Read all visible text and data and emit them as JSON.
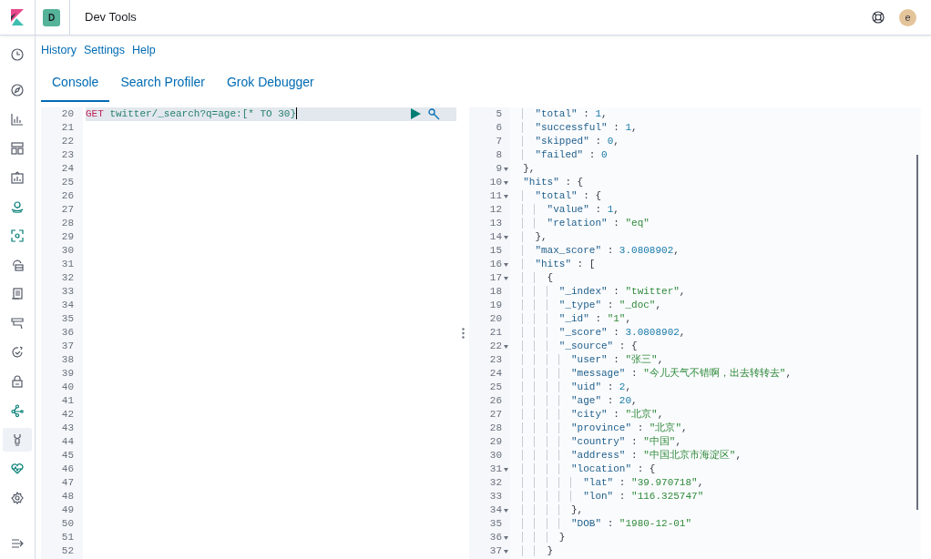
{
  "header": {
    "app_badge": "D",
    "title": "Dev Tools",
    "avatar": "e"
  },
  "nav_items": [
    {
      "selected": false
    },
    {
      "selected": false
    },
    {
      "selected": false
    },
    {
      "selected": false
    },
    {
      "selected": false
    },
    {
      "selected": false
    },
    {
      "selected": false
    },
    {
      "selected": false
    },
    {
      "selected": false
    },
    {
      "selected": false
    },
    {
      "selected": false
    },
    {
      "selected": false
    },
    {
      "selected": false
    },
    {
      "selected": true
    },
    {
      "selected": false
    },
    {
      "selected": false
    }
  ],
  "top_links": [
    "History",
    "Settings",
    "Help"
  ],
  "tabs": [
    {
      "label": "Console",
      "selected": true
    },
    {
      "label": "Search Profiler",
      "selected": false
    },
    {
      "label": "Grok Debugger",
      "selected": false
    }
  ],
  "request_editor": {
    "lines": [
      {
        "n": "20",
        "selected": true,
        "tokens": [
          {
            "kind": "method",
            "text": "GET"
          },
          {
            "kind": "path",
            "text": "twitter/_search?q=age:[* TO 30}"
          }
        ]
      },
      {
        "n": "21",
        "selected": false
      },
      {
        "n": "22",
        "selected": false
      },
      {
        "n": "23",
        "selected": false
      },
      {
        "n": "24",
        "selected": false
      },
      {
        "n": "25",
        "selected": false
      },
      {
        "n": "26",
        "selected": false
      },
      {
        "n": "27",
        "selected": false
      },
      {
        "n": "28",
        "selected": false
      },
      {
        "n": "29",
        "selected": false
      },
      {
        "n": "30",
        "selected": false
      },
      {
        "n": "31",
        "selected": false
      },
      {
        "n": "32",
        "selected": false
      },
      {
        "n": "33",
        "selected": false
      },
      {
        "n": "34",
        "selected": false
      },
      {
        "n": "35",
        "selected": false
      },
      {
        "n": "36",
        "selected": false
      },
      {
        "n": "37",
        "selected": false
      },
      {
        "n": "38",
        "selected": false
      },
      {
        "n": "39",
        "selected": false
      },
      {
        "n": "40",
        "selected": false
      },
      {
        "n": "41",
        "selected": false
      },
      {
        "n": "42",
        "selected": false
      },
      {
        "n": "43",
        "selected": false
      },
      {
        "n": "44",
        "selected": false
      },
      {
        "n": "45",
        "selected": false
      },
      {
        "n": "46",
        "selected": false
      },
      {
        "n": "47",
        "selected": false
      },
      {
        "n": "48",
        "selected": false
      },
      {
        "n": "49",
        "selected": false
      },
      {
        "n": "50",
        "selected": false
      },
      {
        "n": "51",
        "selected": false
      },
      {
        "n": "52",
        "selected": false
      }
    ]
  },
  "response_viewer": {
    "lines": [
      {
        "n": "5",
        "fold": false,
        "tokens": [
          {
            "kind": "key",
            "text": "    \"total\""
          },
          {
            "kind": "punct",
            "text": " : "
          },
          {
            "kind": "num",
            "text": "1"
          },
          {
            "kind": "punct",
            "text": ","
          }
        ]
      },
      {
        "n": "6",
        "fold": false,
        "tokens": [
          {
            "kind": "key",
            "text": "    \"successful\""
          },
          {
            "kind": "punct",
            "text": " : "
          },
          {
            "kind": "num",
            "text": "1"
          },
          {
            "kind": "punct",
            "text": ","
          }
        ]
      },
      {
        "n": "7",
        "fold": false,
        "tokens": [
          {
            "kind": "key",
            "text": "    \"skipped\""
          },
          {
            "kind": "punct",
            "text": " : "
          },
          {
            "kind": "num",
            "text": "0"
          },
          {
            "kind": "punct",
            "text": ","
          }
        ]
      },
      {
        "n": "8",
        "fold": false,
        "tokens": [
          {
            "kind": "key",
            "text": "    \"failed\""
          },
          {
            "kind": "punct",
            "text": " : "
          },
          {
            "kind": "num",
            "text": "0"
          }
        ]
      },
      {
        "n": "9",
        "fold": true,
        "tokens": [
          {
            "kind": "punct",
            "text": "  },"
          }
        ]
      },
      {
        "n": "10",
        "fold": true,
        "tokens": [
          {
            "kind": "key",
            "text": "  \"hits\""
          },
          {
            "kind": "punct",
            "text": " : {"
          }
        ]
      },
      {
        "n": "11",
        "fold": true,
        "tokens": [
          {
            "kind": "key",
            "text": "    \"total\""
          },
          {
            "kind": "punct",
            "text": " : {"
          }
        ]
      },
      {
        "n": "12",
        "fold": false,
        "tokens": [
          {
            "kind": "key",
            "text": "      \"value\""
          },
          {
            "kind": "punct",
            "text": " : "
          },
          {
            "kind": "num",
            "text": "1"
          },
          {
            "kind": "punct",
            "text": ","
          }
        ]
      },
      {
        "n": "13",
        "fold": false,
        "tokens": [
          {
            "kind": "key",
            "text": "      \"relation\""
          },
          {
            "kind": "punct",
            "text": " : "
          },
          {
            "kind": "str",
            "text": "\"eq\""
          }
        ]
      },
      {
        "n": "14",
        "fold": true,
        "tokens": [
          {
            "kind": "punct",
            "text": "    },"
          }
        ]
      },
      {
        "n": "15",
        "fold": false,
        "tokens": [
          {
            "kind": "key",
            "text": "    \"max_score\""
          },
          {
            "kind": "punct",
            "text": " : "
          },
          {
            "kind": "num",
            "text": "3.0808902"
          },
          {
            "kind": "punct",
            "text": ","
          }
        ]
      },
      {
        "n": "16",
        "fold": true,
        "tokens": [
          {
            "kind": "key",
            "text": "    \"hits\""
          },
          {
            "kind": "punct",
            "text": " : ["
          }
        ]
      },
      {
        "n": "17",
        "fold": true,
        "tokens": [
          {
            "kind": "punct",
            "text": "      {"
          }
        ]
      },
      {
        "n": "18",
        "fold": false,
        "tokens": [
          {
            "kind": "key",
            "text": "        \"_index\""
          },
          {
            "kind": "punct",
            "text": " : "
          },
          {
            "kind": "str",
            "text": "\"twitter\""
          },
          {
            "kind": "punct",
            "text": ","
          }
        ]
      },
      {
        "n": "19",
        "fold": false,
        "tokens": [
          {
            "kind": "key",
            "text": "        \"_type\""
          },
          {
            "kind": "punct",
            "text": " : "
          },
          {
            "kind": "str",
            "text": "\"_doc\""
          },
          {
            "kind": "punct",
            "text": ","
          }
        ]
      },
      {
        "n": "20",
        "fold": false,
        "tokens": [
          {
            "kind": "key",
            "text": "        \"_id\""
          },
          {
            "kind": "punct",
            "text": " : "
          },
          {
            "kind": "str",
            "text": "\"1\""
          },
          {
            "kind": "punct",
            "text": ","
          }
        ]
      },
      {
        "n": "21",
        "fold": false,
        "tokens": [
          {
            "kind": "key",
            "text": "        \"_score\""
          },
          {
            "kind": "punct",
            "text": " : "
          },
          {
            "kind": "num",
            "text": "3.0808902"
          },
          {
            "kind": "punct",
            "text": ","
          }
        ]
      },
      {
        "n": "22",
        "fold": true,
        "tokens": [
          {
            "kind": "key",
            "text": "        \"_source\""
          },
          {
            "kind": "punct",
            "text": " : {"
          }
        ]
      },
      {
        "n": "23",
        "fold": false,
        "tokens": [
          {
            "kind": "key",
            "text": "          \"user\""
          },
          {
            "kind": "punct",
            "text": " : "
          },
          {
            "kind": "str",
            "text": "\"张三\""
          },
          {
            "kind": "punct",
            "text": ","
          }
        ]
      },
      {
        "n": "24",
        "fold": false,
        "tokens": [
          {
            "kind": "key",
            "text": "          \"message\""
          },
          {
            "kind": "punct",
            "text": " : "
          },
          {
            "kind": "str",
            "text": "\"今儿天气不错啊，出去转转去\""
          },
          {
            "kind": "punct",
            "text": ","
          }
        ]
      },
      {
        "n": "25",
        "fold": false,
        "tokens": [
          {
            "kind": "key",
            "text": "          \"uid\""
          },
          {
            "kind": "punct",
            "text": " : "
          },
          {
            "kind": "num",
            "text": "2"
          },
          {
            "kind": "punct",
            "text": ","
          }
        ]
      },
      {
        "n": "26",
        "fold": false,
        "tokens": [
          {
            "kind": "key",
            "text": "          \"age\""
          },
          {
            "kind": "punct",
            "text": " : "
          },
          {
            "kind": "num",
            "text": "20"
          },
          {
            "kind": "punct",
            "text": ","
          }
        ]
      },
      {
        "n": "27",
        "fold": false,
        "tokens": [
          {
            "kind": "key",
            "text": "          \"city\""
          },
          {
            "kind": "punct",
            "text": " : "
          },
          {
            "kind": "str",
            "text": "\"北京\""
          },
          {
            "kind": "punct",
            "text": ","
          }
        ]
      },
      {
        "n": "28",
        "fold": false,
        "tokens": [
          {
            "kind": "key",
            "text": "          \"province\""
          },
          {
            "kind": "punct",
            "text": " : "
          },
          {
            "kind": "str",
            "text": "\"北京\""
          },
          {
            "kind": "punct",
            "text": ","
          }
        ]
      },
      {
        "n": "29",
        "fold": false,
        "tokens": [
          {
            "kind": "key",
            "text": "          \"country\""
          },
          {
            "kind": "punct",
            "text": " : "
          },
          {
            "kind": "str",
            "text": "\"中国\""
          },
          {
            "kind": "punct",
            "text": ","
          }
        ]
      },
      {
        "n": "30",
        "fold": false,
        "tokens": [
          {
            "kind": "key",
            "text": "          \"address\""
          },
          {
            "kind": "punct",
            "text": " : "
          },
          {
            "kind": "str",
            "text": "\"中国北京市海淀区\""
          },
          {
            "kind": "punct",
            "text": ","
          }
        ]
      },
      {
        "n": "31",
        "fold": true,
        "tokens": [
          {
            "kind": "key",
            "text": "          \"location\""
          },
          {
            "kind": "punct",
            "text": " : {"
          }
        ]
      },
      {
        "n": "32",
        "fold": false,
        "tokens": [
          {
            "kind": "key",
            "text": "            \"lat\""
          },
          {
            "kind": "punct",
            "text": " : "
          },
          {
            "kind": "str",
            "text": "\"39.970718\""
          },
          {
            "kind": "punct",
            "text": ","
          }
        ]
      },
      {
        "n": "33",
        "fold": false,
        "tokens": [
          {
            "kind": "key",
            "text": "            \"lon\""
          },
          {
            "kind": "punct",
            "text": " : "
          },
          {
            "kind": "str",
            "text": "\"116.325747\""
          }
        ]
      },
      {
        "n": "34",
        "fold": true,
        "tokens": [
          {
            "kind": "punct",
            "text": "          },"
          }
        ]
      },
      {
        "n": "35",
        "fold": false,
        "tokens": [
          {
            "kind": "key",
            "text": "          \"DOB\""
          },
          {
            "kind": "punct",
            "text": " : "
          },
          {
            "kind": "str",
            "text": "\"1980-12-01\""
          }
        ]
      },
      {
        "n": "36",
        "fold": true,
        "tokens": [
          {
            "kind": "punct",
            "text": "        }"
          }
        ]
      },
      {
        "n": "37",
        "fold": true,
        "tokens": [
          {
            "kind": "punct",
            "text": "      }"
          }
        ]
      }
    ]
  }
}
